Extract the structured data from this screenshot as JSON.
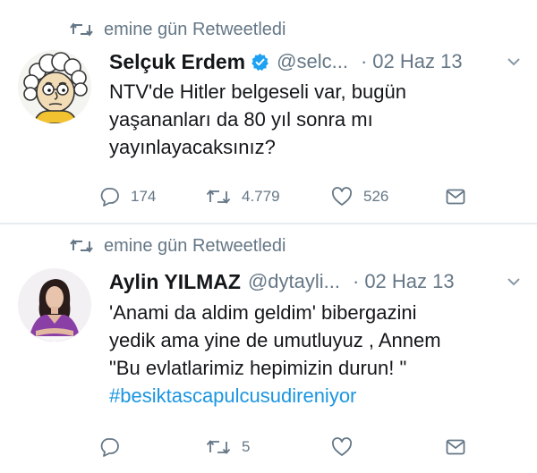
{
  "tweets": [
    {
      "retweeted_by": "emine gün Retweetledi",
      "author_name": "Selçuk Erdem",
      "verified": true,
      "handle": "@selc...",
      "separator": "·",
      "date": "02 Haz 13",
      "lines": [
        "NTV'de Hitler belgeseli var, bugün",
        "yaşananları da 80 yıl sonra mı",
        "yayınlayacaksınız?"
      ],
      "reply_count": "174",
      "retweet_count": "4.779",
      "like_count": "526"
    },
    {
      "retweeted_by": "emine gün Retweetledi",
      "author_name": "Aylin YILMAZ",
      "verified": false,
      "handle": "@dytayli...",
      "separator": "·",
      "date": "02 Haz 13",
      "lines": [
        "'Anami da aldim geldim' bibergazini",
        "yedik ama yine de umutluyuz , Annem",
        "\"Bu evlatlarimiz hepimizin durun! \""
      ],
      "hashtag": "#besiktascapulcusudireniyor",
      "retweet_count": "5"
    }
  ],
  "colors": {
    "secondary": "#657786",
    "link": "#1b95e0",
    "verified": "#1da1f2",
    "text": "#14171a"
  },
  "icons": [
    "retweet-icon",
    "verified-badge-icon",
    "chevron-down-icon",
    "reply-icon",
    "like-icon",
    "direct-message-icon"
  ]
}
